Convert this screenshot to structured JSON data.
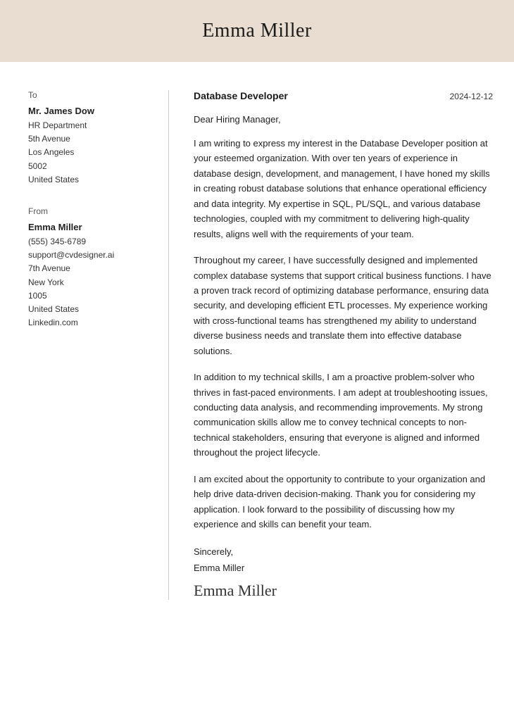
{
  "header": {
    "name": "Emma Miller"
  },
  "left": {
    "to_label": "To",
    "recipient_name": "Mr. James Dow",
    "recipient_details": [
      "HR Department",
      "5th Avenue",
      "Los Angeles",
      "5002",
      "United States"
    ],
    "from_label": "From",
    "sender_name": "Emma Miller",
    "sender_details": [
      "(555) 345-6789",
      "support@cvdesigner.ai",
      "7th Avenue",
      "New York",
      "1005",
      "United States",
      "Linkedin.com"
    ]
  },
  "right": {
    "job_title": "Database Developer",
    "date": "2024-12-12",
    "salutation": "Dear Hiring Manager,",
    "paragraphs": [
      "I am writing to express my interest in the Database Developer position at your esteemed organization. With over ten years of experience in database design, development, and management, I have honed my skills in creating robust database solutions that enhance operational efficiency and data integrity. My expertise in SQL, PL/SQL, and various database technologies, coupled with my commitment to delivering high-quality results, aligns well with the requirements of your team.",
      "Throughout my career, I have successfully designed and implemented complex database systems that support critical business functions. I have a proven track record of optimizing database performance, ensuring data security, and developing efficient ETL processes. My experience working with cross-functional teams has strengthened my ability to understand diverse business needs and translate them into effective database solutions.",
      "In addition to my technical skills, I am a proactive problem-solver who thrives in fast-paced environments. I am adept at troubleshooting issues, conducting data analysis, and recommending improvements. My strong communication skills allow me to convey technical concepts to non-technical stakeholders, ensuring that everyone is aligned and informed throughout the project lifecycle.",
      "I am excited about the opportunity to contribute to your organization and help drive data-driven decision-making. Thank you for considering my application. I look forward to the possibility of discussing how my experience and skills can benefit your team."
    ],
    "closing_line1": "Sincerely,",
    "closing_line2": "Emma Miller",
    "signature": "Emma Miller"
  }
}
